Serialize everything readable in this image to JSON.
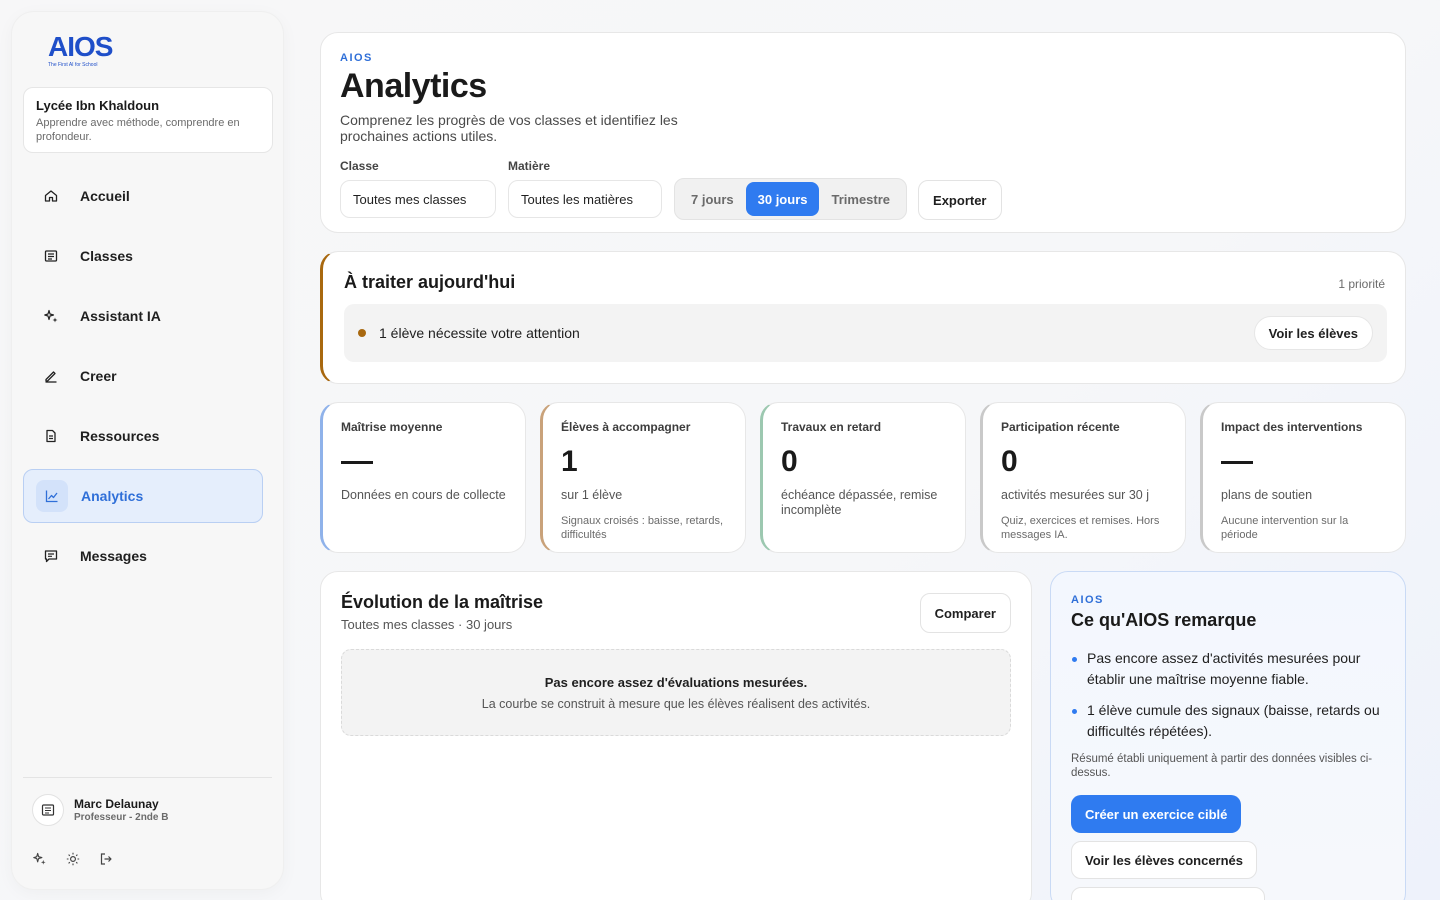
{
  "brand": {
    "logo_text": "AIOS",
    "tagline": "The First AI for School"
  },
  "school": {
    "name": "Lycée Ibn Khaldoun",
    "motto": "Apprendre avec méthode, comprendre en profondeur."
  },
  "sidebar": {
    "items": [
      {
        "label": "Accueil",
        "icon": "home-icon"
      },
      {
        "label": "Classes",
        "icon": "list-icon"
      },
      {
        "label": "Assistant IA",
        "icon": "sparkle-icon"
      },
      {
        "label": "Creer",
        "icon": "pencil-icon"
      },
      {
        "label": "Ressources",
        "icon": "document-icon"
      },
      {
        "label": "Analytics",
        "icon": "chart-icon",
        "active": true
      },
      {
        "label": "Messages",
        "icon": "message-icon"
      }
    ]
  },
  "user": {
    "name": "Marc Delaunay",
    "role": "Professeur - 2nde B"
  },
  "header": {
    "kicker": "AIOS",
    "title": "Analytics",
    "subtitle": "Comprenez les progrès de vos classes et identifiez les prochaines actions utiles.",
    "class_label": "Classe",
    "class_value": "Toutes mes classes",
    "subject_label": "Matière",
    "subject_value": "Toutes les matières",
    "periods": [
      "7 jours",
      "30 jours",
      "Trimestre"
    ],
    "active_period": "30 jours",
    "export_label": "Exporter"
  },
  "today": {
    "title": "À traiter aujourd'hui",
    "count": "1 priorité",
    "item_text": "1 élève nécessite votre attention",
    "action_label": "Voir les élèves"
  },
  "kpis": [
    {
      "title": "Maîtrise moyenne",
      "value": "—",
      "desc": "Données en cours de collecte",
      "note": "",
      "accent": "#8fb2ea"
    },
    {
      "title": "Élèves à accompagner",
      "value": "1",
      "desc": "sur 1 élève",
      "note": "Signaux croisés : baisse, retards, difficultés",
      "accent": "#c9a27a"
    },
    {
      "title": "Travaux en retard",
      "value": "0",
      "desc": "échéance dépassée, remise incomplète",
      "note": "",
      "accent": "#9cc8b0"
    },
    {
      "title": "Participation récente",
      "value": "0",
      "desc": "activités mesurées sur 30 j",
      "note": "Quiz, exercices et remises. Hors messages IA.",
      "accent": "#c9c9c9"
    },
    {
      "title": "Impact des interventions",
      "value": "—",
      "desc": "plans de soutien",
      "note": "Aucune intervention sur la période",
      "accent": "#c9c9c9"
    }
  ],
  "evolution": {
    "title": "Évolution de la maîtrise",
    "subtitle": "Toutes mes classes · 30 jours",
    "compare_label": "Comparer",
    "empty_title": "Pas encore assez d'évaluations mesurées.",
    "empty_text": "La courbe se construit à mesure que les élèves réalisent des activités."
  },
  "remark": {
    "kicker": "AIOS",
    "title": "Ce qu'AIOS remarque",
    "points": [
      "Pas encore assez d'activités mesurées pour établir une maîtrise moyenne fiable.",
      "1 élève cumule des signaux (baisse, retards ou difficultés répétées)."
    ],
    "note": "Résumé établi uniquement à partir des données visibles ci-dessus.",
    "primary_label": "Créer un exercice ciblé",
    "secondary_label": "Voir les élèves concernés"
  },
  "colors": {
    "accent_blue": "#2f7bf0",
    "brand_blue": "#1f4fc9",
    "priority_brown": "#a8680f"
  }
}
